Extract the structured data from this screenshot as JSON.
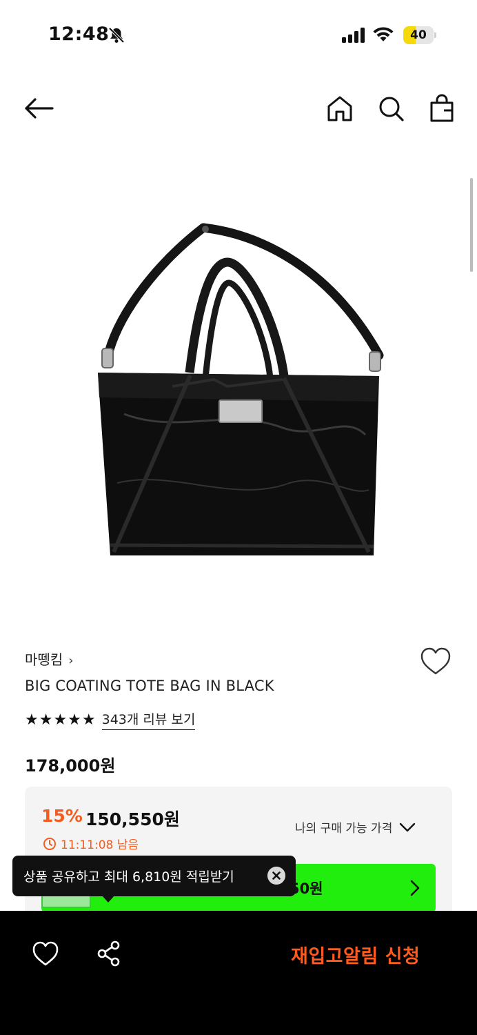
{
  "status_bar": {
    "time": "12:48",
    "battery": "40",
    "battery_level": 0.4,
    "icons": [
      "bell-slash-icon",
      "signal-icon",
      "wifi-icon",
      "battery-icon"
    ]
  },
  "nav": {
    "icons": [
      "back-arrow-icon",
      "home-icon",
      "search-icon",
      "shopping-bag-icon"
    ]
  },
  "product": {
    "brand": "마뗑킴",
    "brand_chevron": "›",
    "title": "BIG COATING TOTE BAG IN BLACK",
    "stars": "★★★★★",
    "rating": 5,
    "review_link": "343개 리뷰 보기",
    "price": "178,000원"
  },
  "discount": {
    "percent": "15%",
    "price": "150,550원",
    "timer": "11:11:08 남음",
    "my_price_label": "나의 구매 가능 가격"
  },
  "promo_bar": {
    "text": "50원",
    "color": "#22ee0e"
  },
  "tooltip": {
    "text": "상품 공유하고 최대 6,810원 적립받기"
  },
  "bottom_bar": {
    "restock_button": "재입고알림 신청",
    "accent_color": "#ff5b1e"
  }
}
